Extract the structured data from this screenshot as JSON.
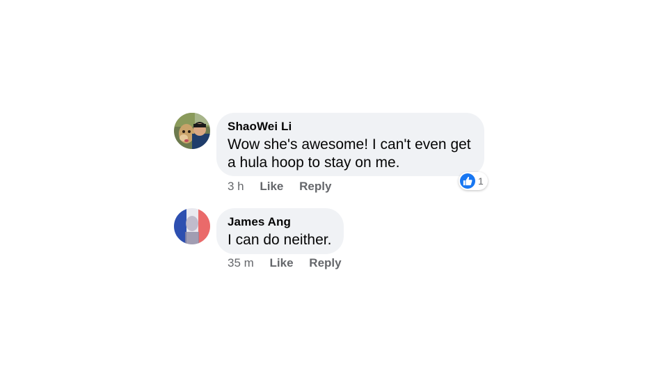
{
  "comments": [
    {
      "author": "ShaoWei Li",
      "text_line1": "Wow she's awesome! I can't even get",
      "text_line2": "a hula hoop to stay on me.",
      "time": "3 h",
      "like_label": "Like",
      "reply_label": "Reply",
      "reaction": {
        "icon": "thumbs-up-icon",
        "count": "1",
        "color": "#1877f2"
      }
    },
    {
      "author": "James Ang",
      "text": "I can do neither.",
      "time": "35 m",
      "like_label": "Like",
      "reply_label": "Reply"
    }
  ],
  "colors": {
    "bubble_bg": "#f0f2f5",
    "meta_text": "#65676b",
    "primary_text": "#050505"
  }
}
